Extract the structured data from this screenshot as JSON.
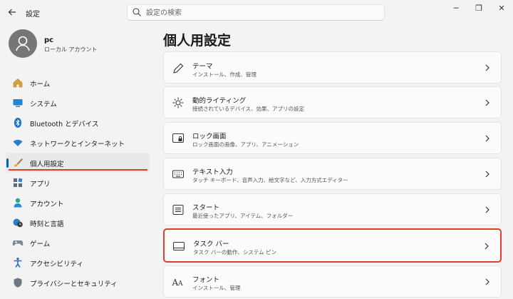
{
  "window": {
    "title": "設定",
    "back_icon": "arrow-left-icon",
    "controls": {
      "minimize": "─",
      "maximize": "❐",
      "close": "✕"
    }
  },
  "search": {
    "placeholder": "設定の検索"
  },
  "user": {
    "name": "pc",
    "account_type": "ローカル アカウント"
  },
  "sidebar": {
    "items": [
      {
        "label": "ホーム",
        "icon": "home-icon"
      },
      {
        "label": "システム",
        "icon": "monitor-icon"
      },
      {
        "label": "Bluetooth とデバイス",
        "icon": "bluetooth-icon"
      },
      {
        "label": "ネットワークとインターネット",
        "icon": "wifi-icon"
      },
      {
        "label": "個人用設定",
        "icon": "brush-icon",
        "selected": true
      },
      {
        "label": "アプリ",
        "icon": "apps-icon"
      },
      {
        "label": "アカウント",
        "icon": "person-icon"
      },
      {
        "label": "時刻と言語",
        "icon": "clock-globe-icon"
      },
      {
        "label": "ゲーム",
        "icon": "gamepad-icon"
      },
      {
        "label": "アクセシビリティ",
        "icon": "accessibility-icon"
      },
      {
        "label": "プライバシーとセキュリティ",
        "icon": "shield-icon"
      }
    ]
  },
  "main": {
    "title": "個人用設定",
    "cards": [
      {
        "title": "テーマ",
        "subtitle": "インストール、作成、管理",
        "icon": "pen-icon"
      },
      {
        "title": "動的ライティング",
        "subtitle": "接続されているデバイス、効果、アプリの設定",
        "icon": "sun-icon"
      },
      {
        "title": "ロック画面",
        "subtitle": "ロック画面の画像、アプリ、アニメーション",
        "icon": "lock-screen-icon"
      },
      {
        "title": "テキスト入力",
        "subtitle": "タッチ キーボード、音声入力、絵文字など、入力方式エディター",
        "icon": "keyboard-icon"
      },
      {
        "title": "スタート",
        "subtitle": "最近使ったアプリ、アイテム、フォルダー",
        "icon": "start-icon"
      },
      {
        "title": "タスク バー",
        "subtitle": "タスク バーの動作、システム ピン",
        "icon": "taskbar-icon",
        "highlighted": true
      },
      {
        "title": "フォント",
        "subtitle": "インストール、管理",
        "icon": "font-icon"
      }
    ]
  },
  "colors": {
    "accent": "#0067c0",
    "highlight": "#e03e2d",
    "background": "#f3f3f3",
    "card": "#fbfbfb"
  }
}
